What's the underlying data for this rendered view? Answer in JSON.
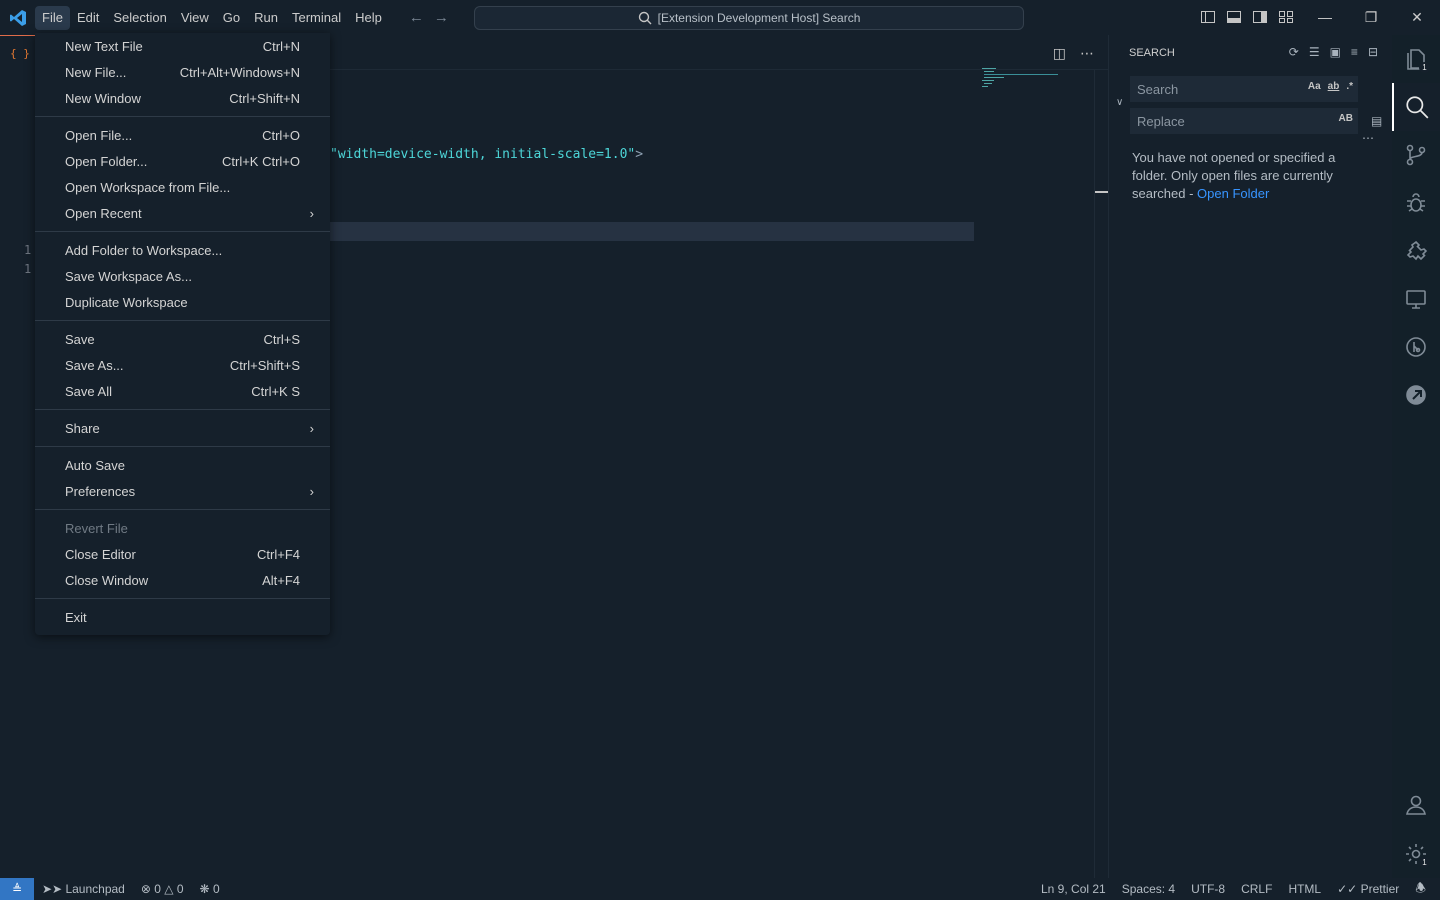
{
  "titlebar": {
    "menus": [
      "File",
      "Edit",
      "Selection",
      "View",
      "Go",
      "Run",
      "Terminal",
      "Help"
    ],
    "command_center": "[Extension Development Host] Search"
  },
  "editor": {
    "tab_icon_text": "{ }",
    "line_numbers": [
      "1",
      "1"
    ],
    "code_text": "\"width=device-width, initial-scale=1.0\"",
    "code_suffix": ">"
  },
  "file_menu": {
    "groups": [
      [
        {
          "label": "New Text File",
          "key": "Ctrl+N"
        },
        {
          "label": "New File...",
          "key": "Ctrl+Alt+Windows+N"
        },
        {
          "label": "New Window",
          "key": "Ctrl+Shift+N"
        }
      ],
      [
        {
          "label": "Open File...",
          "key": "Ctrl+O"
        },
        {
          "label": "Open Folder...",
          "key": "Ctrl+K Ctrl+O"
        },
        {
          "label": "Open Workspace from File...",
          "key": ""
        },
        {
          "label": "Open Recent",
          "key": "",
          "submenu": true
        }
      ],
      [
        {
          "label": "Add Folder to Workspace...",
          "key": ""
        },
        {
          "label": "Save Workspace As...",
          "key": ""
        },
        {
          "label": "Duplicate Workspace",
          "key": ""
        }
      ],
      [
        {
          "label": "Save",
          "key": "Ctrl+S"
        },
        {
          "label": "Save As...",
          "key": "Ctrl+Shift+S"
        },
        {
          "label": "Save All",
          "key": "Ctrl+K S"
        }
      ],
      [
        {
          "label": "Share",
          "key": "",
          "submenu": true
        }
      ],
      [
        {
          "label": "Auto Save",
          "key": ""
        },
        {
          "label": "Preferences",
          "key": "",
          "submenu": true
        }
      ],
      [
        {
          "label": "Revert File",
          "key": "",
          "disabled": true
        },
        {
          "label": "Close Editor",
          "key": "Ctrl+F4"
        },
        {
          "label": "Close Window",
          "key": "Alt+F4"
        }
      ],
      [
        {
          "label": "Exit",
          "key": ""
        }
      ]
    ]
  },
  "search_panel": {
    "title": "SEARCH",
    "search_placeholder": "Search",
    "replace_placeholder": "Replace",
    "search_opts": [
      "Aa",
      "ab",
      ".*"
    ],
    "replace_opts": [
      "AB"
    ],
    "message": "You have not opened or specified a folder. Only open files are currently searched - ",
    "open_folder_link": "Open Folder"
  },
  "activity_bar": {
    "badges": {
      "explorer": "1",
      "settings": "1"
    }
  },
  "status_bar": {
    "left": {
      "launchpad": "Launchpad",
      "errors": "0",
      "warnings": "0",
      "ports": "0"
    },
    "right": [
      "Ln 9, Col 21",
      "Spaces: 4",
      "UTF-8",
      "CRLF",
      "HTML",
      "Prettier"
    ]
  },
  "colors": {
    "accent": "#3276c4",
    "link": "#3794ff",
    "string": "#4dd6d8",
    "background": "#15202b"
  }
}
